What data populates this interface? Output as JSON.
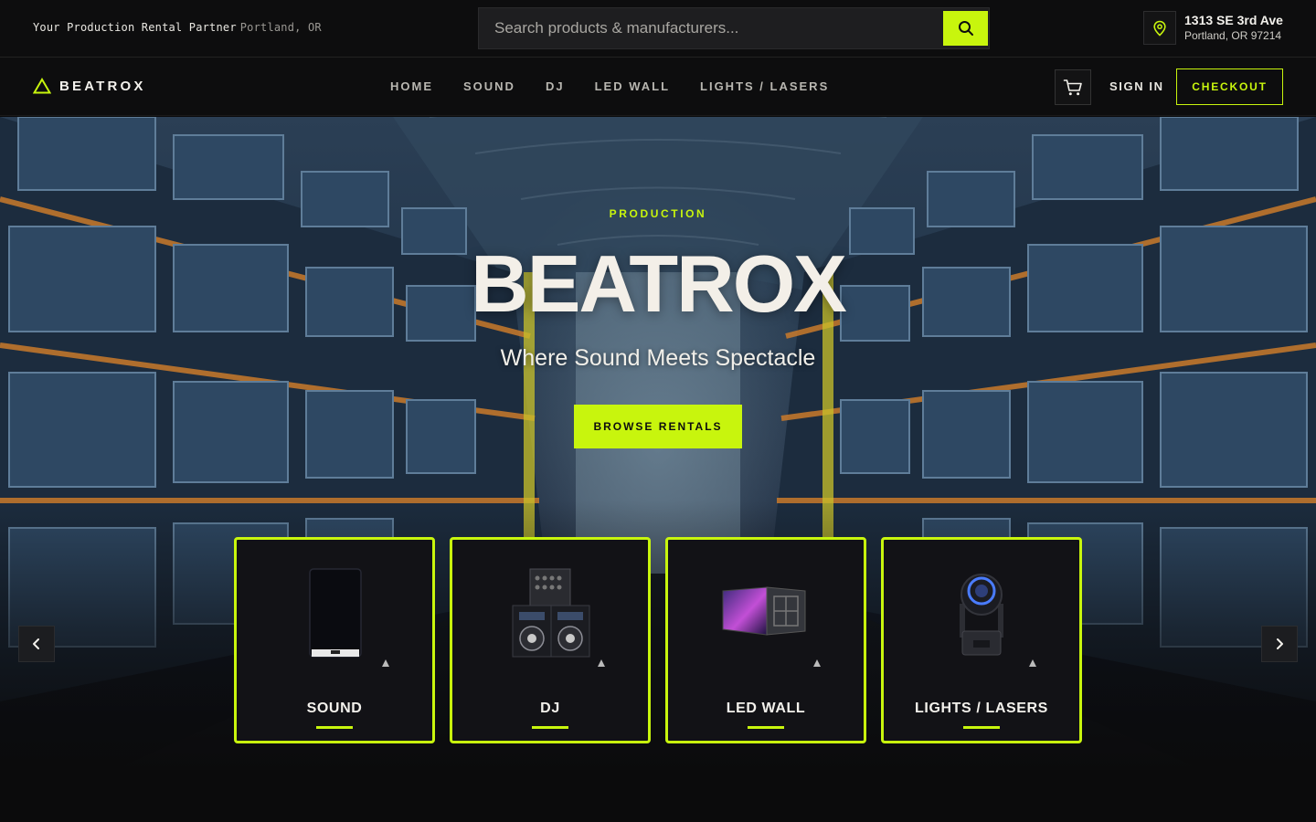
{
  "topbar": {
    "tagline": "Your Production Rental Partner",
    "location": "Portland, OR",
    "search_placeholder": "Search products & manufacturers...",
    "address_line1": "1313 SE 3rd Ave",
    "address_line2": "Portland, OR 97214",
    "icons": {
      "search": "search-icon",
      "pin": "map-pin-icon"
    }
  },
  "nav": {
    "brand": "BEATROX",
    "links": [
      "HOME",
      "SOUND",
      "DJ",
      "LED WALL",
      "LIGHTS / LASERS"
    ],
    "sign_in": "SIGN IN",
    "checkout": "CHECKOUT",
    "icons": {
      "logo": "triangle-logo-icon",
      "cart": "cart-icon"
    }
  },
  "hero": {
    "eyebrow": "PRODUCTION",
    "title": "BEATROX",
    "subtitle": "Where Sound Meets Spectacle",
    "cta": "BROWSE RENTALS"
  },
  "categories": [
    {
      "label": "SOUND",
      "icon": "speaker-icon"
    },
    {
      "label": "DJ",
      "icon": "dj-controller-icon"
    },
    {
      "label": "LED WALL",
      "icon": "led-panel-icon"
    },
    {
      "label": "LIGHTS / LASERS",
      "icon": "moving-head-light-icon"
    }
  ],
  "carousel": {
    "prev_icon": "chevron-left-icon",
    "next_icon": "chevron-right-icon"
  },
  "colors": {
    "accent": "#c8f50d",
    "background": "#0b0b0c",
    "text": "#f3f1ec"
  }
}
